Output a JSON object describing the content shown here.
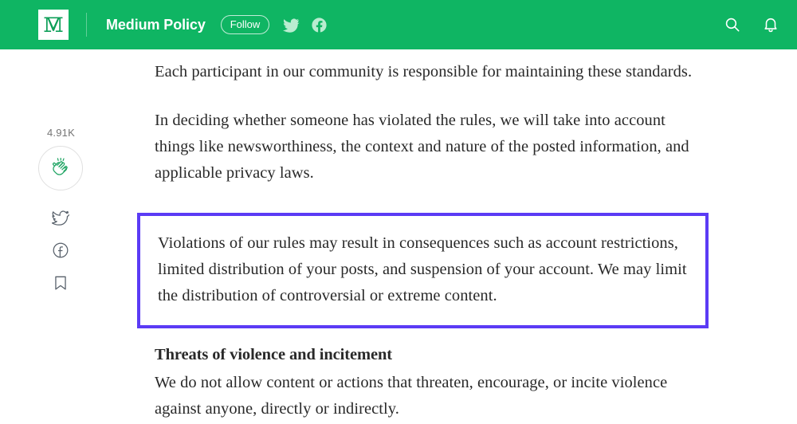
{
  "header": {
    "logo_icon": "medium-m-logo",
    "publication_title": "Medium Policy",
    "follow_label": "Follow",
    "twitter_icon": "twitter-bird-icon",
    "facebook_icon": "facebook-circle-icon",
    "search_icon": "search-icon",
    "notifications_icon": "bell-icon",
    "background_color": "#0fb563",
    "logo_color": "#0fb563",
    "text_color": "#ffffff"
  },
  "action_rail": {
    "clap_count": "4.91K",
    "clap_icon": "clapping-hands-icon",
    "clap_icon_color": "#1fa463",
    "twitter_icon": "twitter-bird-icon",
    "facebook_icon": "facebook-circle-icon",
    "bookmark_icon": "bookmark-icon",
    "icon_color": "#57606a"
  },
  "article": {
    "paragraph_intro": "Each participant in our community is responsible for maintaining these standards.",
    "paragraph_deciding": "In deciding whether someone has violated the rules, we will take into account things like newsworthiness, the context and nature of the posted information, and applicable privacy laws.",
    "highlight": {
      "text": "Violations of our rules may result in consequences such as account restrictions, limited distribution of your posts, and suspension of your account. We may limit the distribution of controversial or extreme content.",
      "border_color": "#5b3bf5"
    },
    "section_heading": "Threats of violence and incitement",
    "paragraph_threats": "We do not allow content or actions that threaten, encourage, or incite violence against anyone, directly or indirectly.",
    "text_color": "#292929"
  }
}
